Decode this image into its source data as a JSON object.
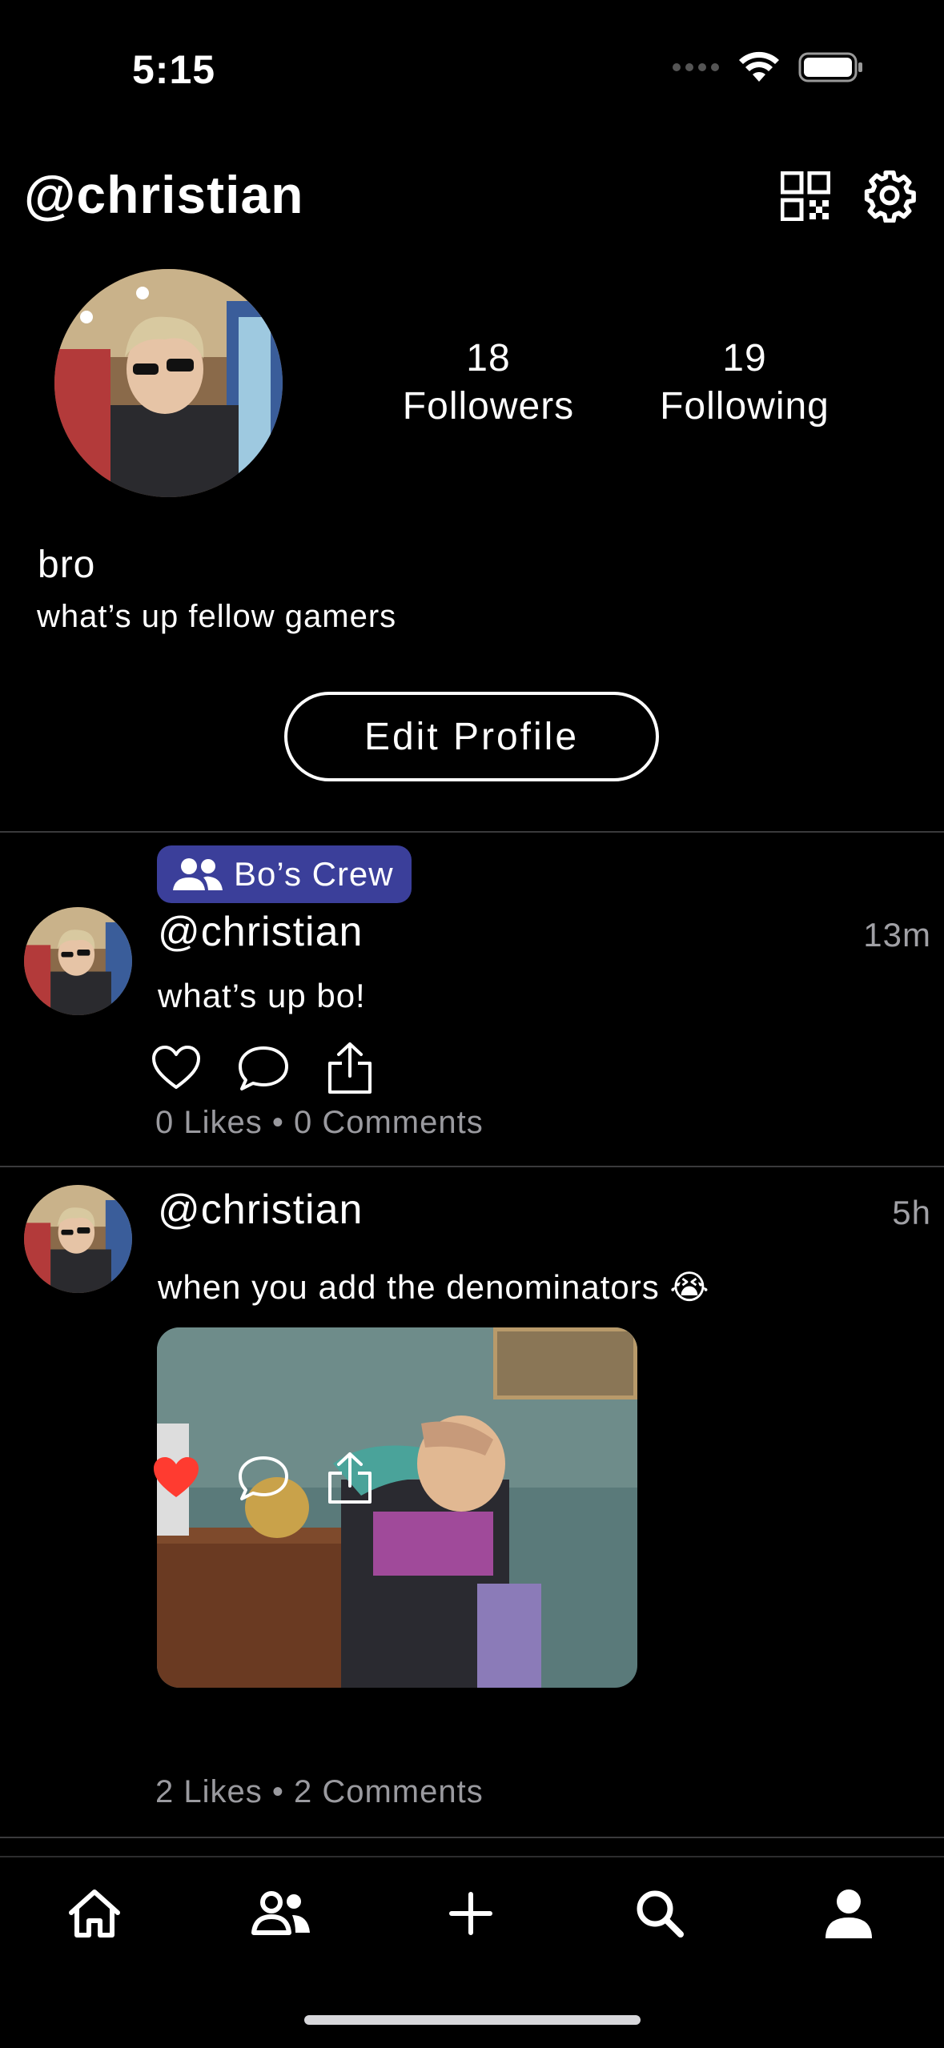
{
  "status_bar": {
    "time": "5:15"
  },
  "header": {
    "handle": "@christian",
    "icons": [
      "qr-code-icon",
      "gear-icon"
    ]
  },
  "profile": {
    "followers_count": "18",
    "followers_label": "Followers",
    "following_count": "19",
    "following_label": "Following",
    "name": "bro",
    "bio": "what’s up fellow gamers",
    "edit_button": "Edit Profile"
  },
  "posts": [
    {
      "group": "Bo’s Crew",
      "user": "@christian",
      "time": "13m",
      "text": "what’s up bo!",
      "liked": false,
      "counts": "0 Likes • 0 Comments"
    },
    {
      "user": "@christian",
      "time": "5h",
      "text": "when you add the denominators 😭",
      "liked": true,
      "counts": "2 Likes • 2 Comments"
    }
  ],
  "tabbar": {
    "tabs": [
      "home-icon",
      "friends-icon",
      "plus-icon",
      "search-icon",
      "profile-icon"
    ],
    "active": "profile-icon"
  },
  "colors": {
    "background": "#000000",
    "group_chip": "#3b3f9a",
    "like_red": "#ff3b30",
    "muted_text": "#9a9a9f"
  }
}
